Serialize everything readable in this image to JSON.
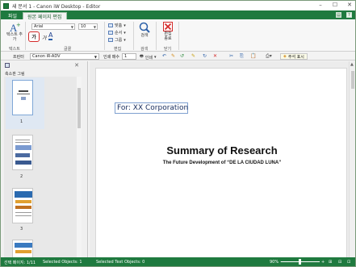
{
  "window": {
    "title": "새 문서 1 - Canon iW Desktop - Editor"
  },
  "tabs": [
    {
      "label": "파일",
      "active": false
    },
    {
      "label": "원본 페이지 편집",
      "active": true
    }
  ],
  "ribbon": {
    "text_button": "텍스트 추가",
    "font_name": "Arial",
    "font_size": "10",
    "bold": "가",
    "italic": "가",
    "font_color": "A",
    "align_label": "맞춤",
    "order_label": "순서",
    "group_label": "그룹",
    "find_button": "검색",
    "exit_button": "편집 종료",
    "groups": {
      "text": "텍스트",
      "font": "글꼴",
      "edit": "편집",
      "search": "검색",
      "close": "닫기"
    }
  },
  "printer_bar": {
    "printer_label": "프린터",
    "printer_value": "Canon iR-ADV",
    "copies_label": "인쇄 매수",
    "copies_value": "1",
    "print_label": "인쇄",
    "annotation_label": "주석 표시"
  },
  "left_panel": {
    "title": "축소판 그림",
    "thumbnails": [
      {
        "num": "1"
      },
      {
        "num": "2"
      },
      {
        "num": "3"
      }
    ]
  },
  "document": {
    "annotation_text": "For: XX Corporation",
    "title": "Summary of Research",
    "subtitle": "The Future Development of “DE LA CIUDAD LUNA”"
  },
  "status": {
    "page": "선택 페이지: 1/11",
    "selected_objects": "Selected Objects: 1",
    "selected_text_objects": "Selected Text Objects: 0",
    "zoom": "90%"
  }
}
